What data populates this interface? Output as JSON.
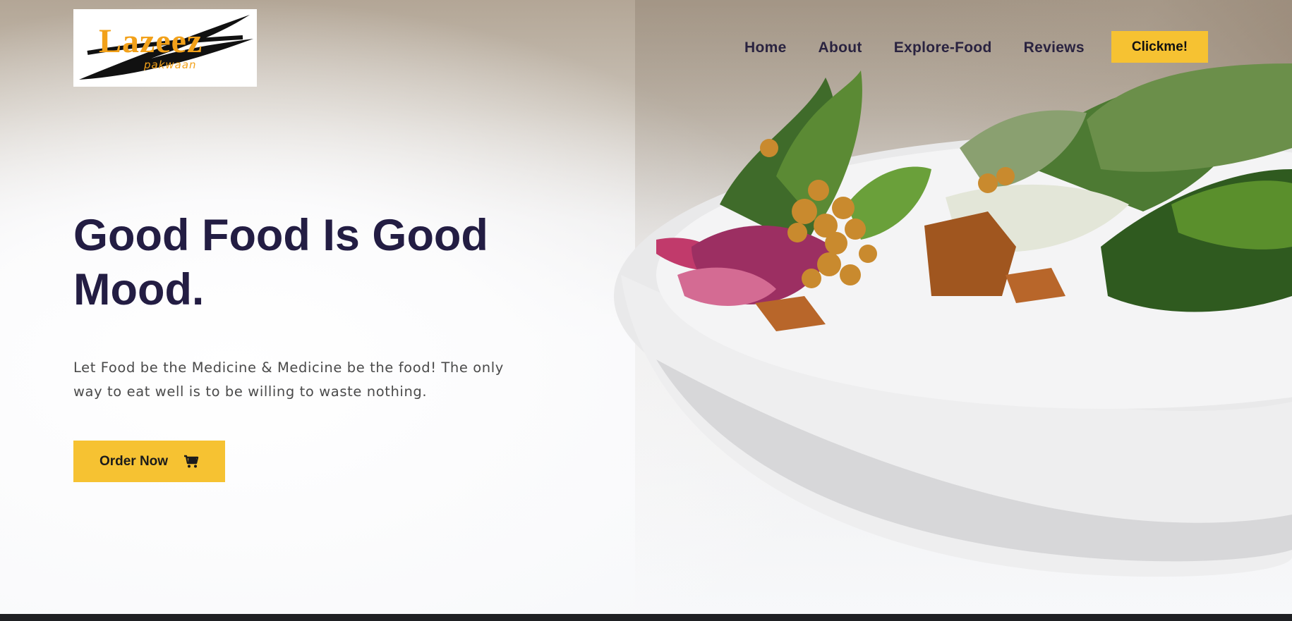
{
  "brand": {
    "name": "Lazeez",
    "tagline": "pakwaan",
    "color": "#f2a11a"
  },
  "nav": {
    "items": [
      {
        "label": "Home"
      },
      {
        "label": "About"
      },
      {
        "label": "Explore-Food"
      },
      {
        "label": "Reviews"
      }
    ],
    "cta_label": "Clickme!"
  },
  "hero": {
    "headline": "Good Food Is Good Mood.",
    "text": "Let Food be the Medicine & Medicine be the food! The only way to eat well is to be willing to waste nothing.",
    "order_button_label": "Order Now",
    "order_button_icon": "shopping-cart-icon",
    "image": "salad-bowl-image"
  },
  "colors": {
    "accent": "#f6c232",
    "heading": "#231d43",
    "nav_text": "#2a2340",
    "body_text": "#4a4a4a"
  }
}
